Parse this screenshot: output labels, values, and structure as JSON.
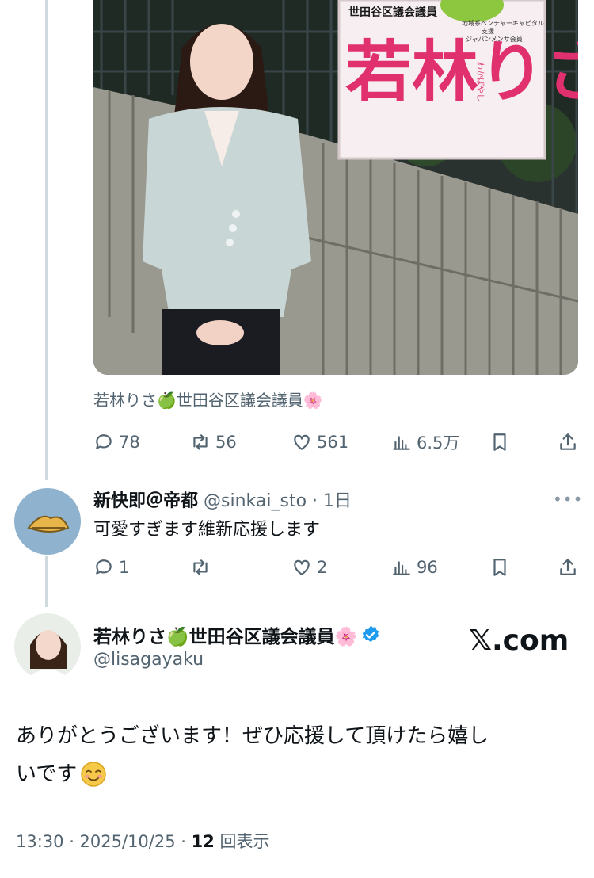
{
  "top_tweet": {
    "media": {
      "sign_title": "世田谷区議会議員",
      "sign_name": "若林りさ",
      "sign_furigana": "わかばやし",
      "sign_small_lines": [
        "地域系ベンチャーキャピタル",
        "支援",
        "ジャパンメンサ会員"
      ]
    },
    "caption": "若林りさ🍏世田谷区議会議員🌸",
    "actions": {
      "replies": "78",
      "retweets": "56",
      "likes": "561",
      "views": "6.5万"
    }
  },
  "reply": {
    "display_name": "新快即＠帝都",
    "handle_time": "@sinkai_sto · 1日",
    "text": "可愛すぎます維新応援します",
    "more": "•••",
    "actions": {
      "replies": "1",
      "retweets": "",
      "likes": "2",
      "views": "96"
    }
  },
  "main_tweet": {
    "display_name": "若林りさ🍏世田谷区議会議員🌸",
    "handle": "@lisagayaku",
    "text_line1": "ありがとうございます！ぜひ応援して頂けたら嬉し",
    "text_line2": "いです",
    "time": "13:30 · 2025/10/25 · ",
    "view_count": "12",
    "view_label": " 回表示"
  },
  "watermark": "𝕏.com",
  "colors": {
    "verified": "#1d9bf0",
    "muted": "#536471",
    "thread_line": "#cfd9de",
    "sign_pink": "#e0306e"
  },
  "icons": [
    "reply-icon",
    "retweet-icon",
    "like-icon",
    "views-icon",
    "bookmark-icon",
    "share-icon",
    "verified-badge-icon",
    "more-icon"
  ]
}
